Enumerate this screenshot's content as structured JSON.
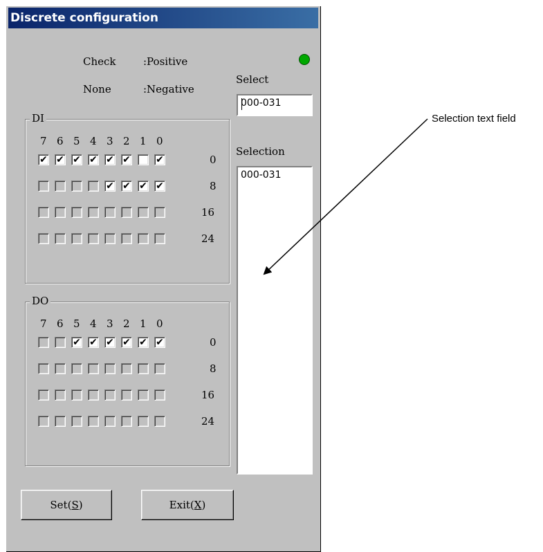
{
  "window": {
    "title": "Discrete configuration"
  },
  "legend_info": {
    "check_label": "Check",
    "check_value": ":Positive",
    "none_label": "None",
    "none_value": ":Negative"
  },
  "status_led_color": "#00a800",
  "select": {
    "label": "Select",
    "value": "000-031"
  },
  "selection": {
    "label": "Selection",
    "items": [
      "000-031"
    ]
  },
  "di": {
    "title": "DI",
    "bit_headers": [
      "7",
      "6",
      "5",
      "4",
      "3",
      "2",
      "1",
      "0"
    ],
    "rows": [
      {
        "offset": "0",
        "bits": [
          true,
          true,
          true,
          true,
          true,
          true,
          false,
          true
        ],
        "enabled": true
      },
      {
        "offset": "8",
        "bits": [
          false,
          false,
          false,
          false,
          true,
          true,
          true,
          true
        ],
        "enabled": false
      },
      {
        "offset": "16",
        "bits": [
          false,
          false,
          false,
          false,
          false,
          false,
          false,
          false
        ],
        "enabled": false
      },
      {
        "offset": "24",
        "bits": [
          false,
          false,
          false,
          false,
          false,
          false,
          false,
          false
        ],
        "enabled": false
      }
    ]
  },
  "do": {
    "title": "DO",
    "bit_headers": [
      "7",
      "6",
      "5",
      "4",
      "3",
      "2",
      "1",
      "0"
    ],
    "rows": [
      {
        "offset": "0",
        "bits": [
          false,
          false,
          true,
          true,
          true,
          true,
          true,
          true
        ],
        "enabled": false
      },
      {
        "offset": "8",
        "bits": [
          false,
          false,
          false,
          false,
          false,
          false,
          false,
          false
        ],
        "enabled": false
      },
      {
        "offset": "16",
        "bits": [
          false,
          false,
          false,
          false,
          false,
          false,
          false,
          false
        ],
        "enabled": false
      },
      {
        "offset": "24",
        "bits": [
          false,
          false,
          false,
          false,
          false,
          false,
          false,
          false
        ],
        "enabled": false
      }
    ]
  },
  "buttons": {
    "set": {
      "text": "Set(",
      "key": "S",
      "close": ")"
    },
    "exit": {
      "text": "Exit(",
      "key": "X",
      "close": ")"
    }
  },
  "annotation": "Selection text field"
}
